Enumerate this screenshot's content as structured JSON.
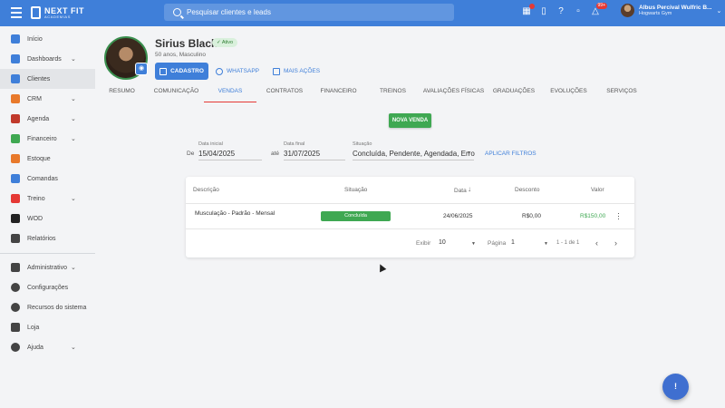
{
  "header": {
    "logo_title": "NEXT FIT",
    "logo_sub": "ACADEMIAS",
    "search_placeholder": "Pesquisar clientes e leads",
    "notif_badge": "99+",
    "user_name": "Albus Percival Wulfric B...",
    "user_gym": "Hogwarts Gym"
  },
  "sidebar": {
    "items": [
      {
        "label": "Início",
        "color": "#3f7fd9"
      },
      {
        "label": "Dashboards",
        "color": "#3f7fd9"
      },
      {
        "label": "Clientes",
        "color": "#3f7fd9"
      },
      {
        "label": "CRM",
        "color": "#e8792b"
      },
      {
        "label": "Agenda",
        "color": "#c0392b"
      },
      {
        "label": "Financeiro",
        "color": "#3fa852"
      },
      {
        "label": "Estoque",
        "color": "#e8792b"
      },
      {
        "label": "Comandas",
        "color": "#3f7fd9"
      },
      {
        "label": "Treino",
        "color": "#e53935"
      },
      {
        "label": "WOD",
        "color": "#222222"
      },
      {
        "label": "Relatórios",
        "color": "#444444"
      },
      {
        "label": "Administrativo",
        "color": "#444444"
      },
      {
        "label": "Configurações",
        "color": "#444444"
      },
      {
        "label": "Recursos do sistema",
        "color": "#444444"
      },
      {
        "label": "Loja",
        "color": "#444444"
      },
      {
        "label": "Ajuda",
        "color": "#444444"
      }
    ]
  },
  "profile": {
    "name": "Sirius Black",
    "status": "Ativo",
    "subtitle": "50 anos, Masculino",
    "btn_cadastro": "CADASTRO",
    "btn_whatsapp": "WHATSAPP",
    "btn_mais": "MAIS AÇÕES"
  },
  "tabs": [
    "RESUMO",
    "COMUNICAÇÃO",
    "VENDAS",
    "CONTRATOS",
    "FINANCEIRO",
    "TREINOS",
    "AVALIAÇÕES FÍSICAS",
    "GRADUAÇÕES",
    "EVOLUÇÕES",
    "SERVIÇOS"
  ],
  "active_tab": "VENDAS",
  "actions": {
    "nova_venda": "NOVA VENDA"
  },
  "filters": {
    "de_label": "De",
    "data_inicial_label": "Data inicial",
    "data_inicial": "15/04/2025",
    "ate_label": "até",
    "data_final_label": "Data final",
    "data_final": "31/07/2025",
    "situacao_label": "Situação",
    "situacao": "Concluída, Pendente, Agendada, Erro",
    "aplicar": "APLICAR FILTROS"
  },
  "table": {
    "headers": {
      "descricao": "Descrição",
      "situacao": "Situação",
      "data": "Data",
      "desconto": "Desconto",
      "valor": "Valor"
    },
    "rows": [
      {
        "descricao": "Musculação - Padrão - Mensal",
        "situacao": "Concluída",
        "data": "24/06/2025",
        "desconto": "R$0,00",
        "valor": "R$150,00"
      }
    ],
    "pagination": {
      "exibir_label": "Exibir",
      "exibir_value": "10",
      "pagina_label": "Página",
      "pagina_value": "1",
      "range": "1 - 1 de 1"
    }
  },
  "fab_label": "!"
}
